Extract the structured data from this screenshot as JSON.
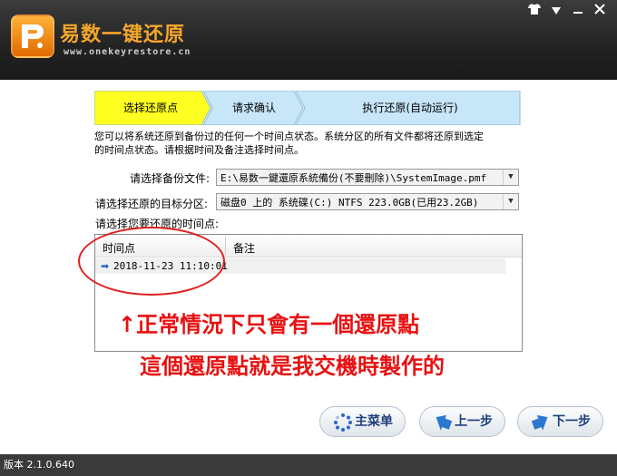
{
  "header": {
    "title": "易数一键还原",
    "url": "www.onekeyrestore.cn",
    "window_buttons": [
      "shirt-icon",
      "menu-icon",
      "minimize-icon",
      "close-icon"
    ]
  },
  "steps": [
    {
      "label": "选择还原点",
      "active": true
    },
    {
      "label": "请求确认",
      "active": false
    },
    {
      "label": "执行还原(自动运行)",
      "active": false
    }
  ],
  "description": {
    "line1": "您可以将系统还原到备份过的任何一个时间点状态。系统分区的所有文件都将还原到选定",
    "line2": "的时间点状态。请根据时间及备注选择时间点。"
  },
  "form": {
    "backup_label": "请选择备份文件:",
    "backup_value": "E:\\易数一鍵還原系統備份(不要刪除)\\SystemImage.pmf",
    "target_label": "请选择还原的目标分区:",
    "target_value": "磁盘0 上的 系统碟(C:) NTFS 223.0GB(已用23.2GB)",
    "timepoint_label": "请选择您要还原的时间点:"
  },
  "list": {
    "columns": [
      "时间点",
      "备注"
    ],
    "rows": [
      {
        "time": "2018-11-23 11:10:01",
        "note": ""
      }
    ]
  },
  "annotation": {
    "line1": "↑正常情況下只會有一個還原點",
    "line2": "這個還原點就是我交機時製作的",
    "color": "#e81010"
  },
  "buttons": {
    "main_menu": "主菜单",
    "prev": "上一步",
    "next": "下一步"
  },
  "status": {
    "version": "版本 2.1.0.640"
  },
  "colors": {
    "active_step": "#ffff22",
    "inactive_step": "#c7e6f7",
    "brand_orange": "#f4a62a"
  }
}
